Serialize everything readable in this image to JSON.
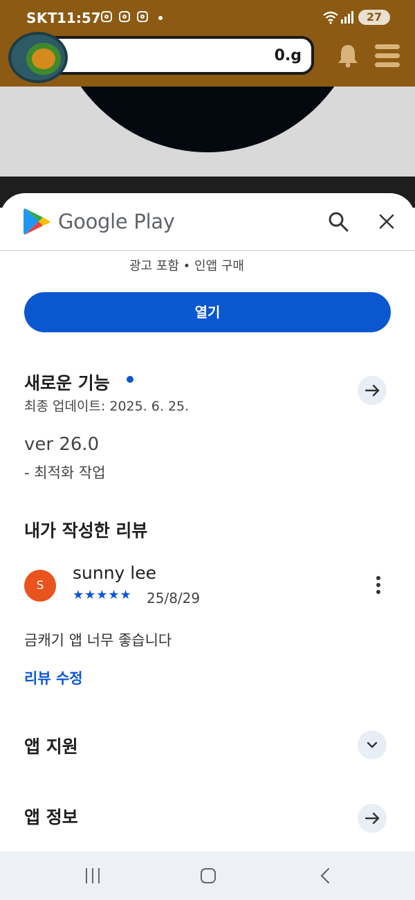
{
  "status_bar": {
    "carrier": "SKT",
    "time": "11:57",
    "battery": "27"
  },
  "background_app": {
    "balance": "0.g"
  },
  "sheet": {
    "store_name": "Google Play",
    "meta_line": "광고 포함 • 인앱 구매",
    "open_label": "열기",
    "whats_new": {
      "title": "새로운 기능",
      "last_updated": "최종 업데이트: 2025. 6. 25.",
      "version": "ver 26.0",
      "changelog": "- 최적화 작업"
    },
    "my_review": {
      "title": "내가 작성한 리뷰",
      "avatar_initial": "S",
      "reviewer": "sunny lee",
      "rating": 5,
      "stars": "★★★★★",
      "date": "25/8/29",
      "text": "금캐기 앱 너무 좋습니다",
      "edit_label": "리뷰 수정"
    },
    "app_support": {
      "title": "앱 지원"
    },
    "app_info": {
      "title": "앱 정보"
    }
  },
  "colors": {
    "accent": "#0b57d0",
    "header_brown": "#8c5a12",
    "avatar": "#e8531e"
  },
  "icons": [
    "instagram-icon",
    "wifi-icon",
    "signal-icon",
    "battery-icon",
    "bell-icon",
    "menu-icon",
    "google-play-logo",
    "search-icon",
    "close-icon",
    "arrow-right-icon",
    "chevron-down-icon",
    "more-vert-icon",
    "recents-icon",
    "home-icon",
    "back-icon"
  ]
}
